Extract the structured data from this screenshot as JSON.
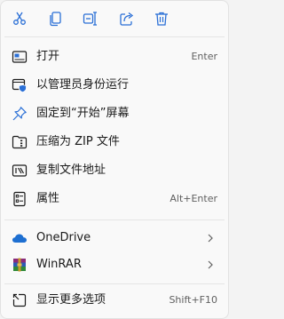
{
  "toolbar": {
    "icons": [
      "cut-icon",
      "copy-icon",
      "rename-icon",
      "share-icon",
      "delete-icon"
    ],
    "accent": "#2a6fd6"
  },
  "items": [
    {
      "label": "打开",
      "shortcut": "Enter",
      "icon": "open-icon"
    },
    {
      "label": "以管理员身份运行",
      "shortcut": "",
      "icon": "run-as-admin-icon"
    },
    {
      "label": "固定到“开始”屏幕",
      "shortcut": "",
      "icon": "pin-icon"
    },
    {
      "label": "压缩为 ZIP 文件",
      "shortcut": "",
      "icon": "zip-icon"
    },
    {
      "label": "复制文件地址",
      "shortcut": "",
      "icon": "copy-path-icon"
    },
    {
      "label": "属性",
      "shortcut": "Alt+Enter",
      "icon": "properties-icon"
    },
    {
      "label": "OneDrive",
      "shortcut": "",
      "icon": "onedrive-icon",
      "submenu": true
    },
    {
      "label": "WinRAR",
      "shortcut": "",
      "icon": "winrar-icon",
      "submenu": true
    },
    {
      "label": "显示更多选项",
      "shortcut": "Shift+F10",
      "icon": "more-options-icon"
    }
  ],
  "colors": {
    "icon_blue": "#2a6fd6",
    "onedrive": "#1e6fd1",
    "text": "#1a1a1a",
    "muted": "#5f5f5f"
  }
}
